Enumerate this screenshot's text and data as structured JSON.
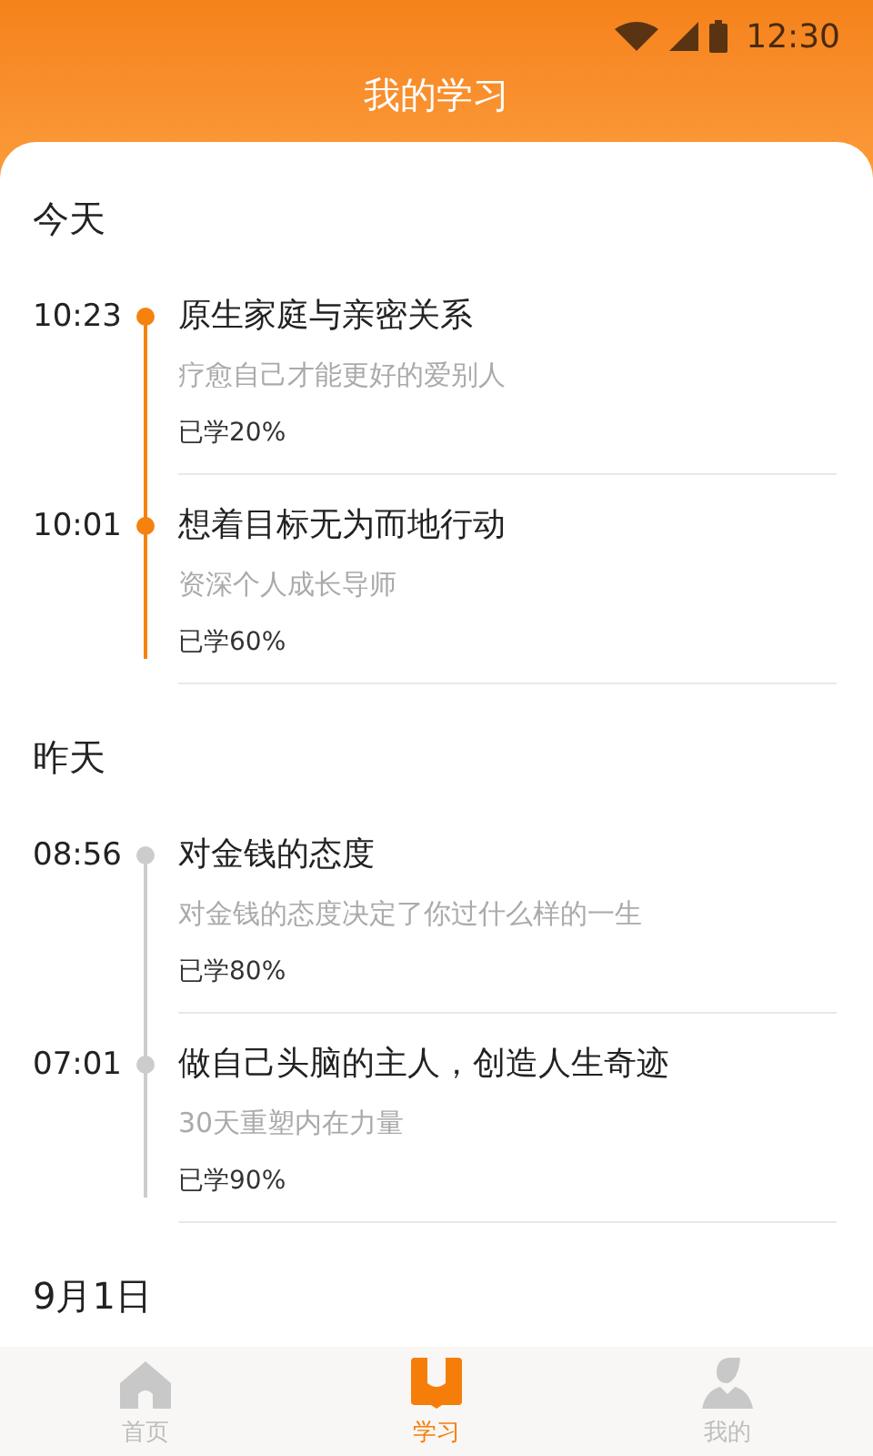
{
  "status_bar": {
    "time": "12:30"
  },
  "title": "我的学习",
  "sections": [
    {
      "heading": "今天",
      "color": "#f5820f",
      "entries": [
        {
          "time": "10:23",
          "title": "原生家庭与亲密关系",
          "subtitle": "疗愈自己才能更好的爱别人",
          "progress": "已学20%"
        },
        {
          "time": "10:01",
          "title": "想着目标无为而地行动",
          "subtitle": "资深个人成长导师",
          "progress": "已学60%"
        }
      ]
    },
    {
      "heading": "昨天",
      "color": "#cccccc",
      "entries": [
        {
          "time": "08:56",
          "title": "对金钱的态度",
          "subtitle": "对金钱的态度决定了你过什么样的一生",
          "progress": "已学80%"
        },
        {
          "time": "07:01",
          "title": "做自己头脑的主人，创造人生奇迹",
          "subtitle": "30天重塑内在力量",
          "progress": "已学90%"
        }
      ]
    },
    {
      "heading": "9月1日"
    }
  ],
  "tabs": [
    {
      "kind": "home",
      "label": "首页",
      "selected": false
    },
    {
      "kind": "study",
      "label": "学习",
      "selected": true
    },
    {
      "kind": "me",
      "label": "我的",
      "selected": false
    }
  ]
}
